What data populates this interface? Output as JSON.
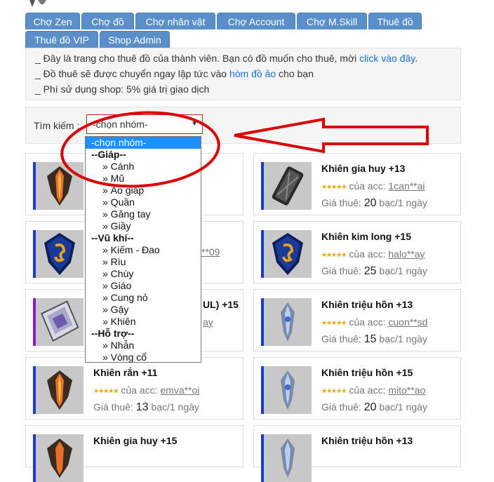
{
  "tabs": [
    "Chợ Zen",
    "Chợ đồ",
    "Chợ nhân vật",
    "Chợ Account",
    "Chợ M.Skill",
    "Thuê đồ",
    "Thuê đồ VIP",
    "Shop Admin"
  ],
  "info": {
    "line1_text": "_ Đây là trang cho thuê đồ của thành viên. Bạn có đồ muốn cho thuê, mời ",
    "line1_link": "click vào đây",
    "line1_end": ".",
    "line2_text": "_ Đồ thuê sẽ được chuyển ngay lập tức vào ",
    "line2_link": "hòm đồ ảo",
    "line2_end": " cho bạn",
    "line3_text": "_ Phí sử dụng shop: 5% giá trị giao dịch"
  },
  "search": {
    "label": "Tìm kiếm :",
    "selected": "-chọn nhóm-"
  },
  "dropdown": {
    "selected": "-chọn nhóm-",
    "groups": [
      {
        "label": "--Giáp--",
        "options": [
          "» Cánh",
          "» Mũ",
          "» Áo giáp",
          "» Quần",
          "» Găng tay",
          "» Giầy"
        ]
      },
      {
        "label": "--Vũ khí--",
        "options": [
          "» Kiếm - Đao",
          "» Rìu",
          "» Chùy",
          "» Giáo",
          "» Cung nỏ",
          "» Gậy",
          "» Khiên"
        ]
      },
      {
        "label": "--Hỗ trợ--",
        "options": [
          "» Nhẫn",
          "» Vòng cổ"
        ]
      }
    ]
  },
  "cards": [
    {
      "title": "",
      "acc_prefix": "",
      "acc": "",
      "price": "",
      "unit": ""
    },
    {
      "title": "Khiên gia huy +13",
      "acc_prefix": "của acc:",
      "acc": "1can**ai",
      "price": "20",
      "unit": "bạc/1 ngày"
    },
    {
      "title": "",
      "acc_prefix": "",
      "acc": "**09",
      "price": "",
      "unit": ""
    },
    {
      "title": "Khiên kim long +15",
      "acc_prefix": "của acc:",
      "acc": "halo**ay",
      "price": "25",
      "unit": "bạc/1 ngày"
    },
    {
      "title": "UL) +15",
      "acc_prefix": "",
      "acc": "ay",
      "price": "",
      "unit": ""
    },
    {
      "title": "Khiên triệu hồn +13",
      "acc_prefix": "của acc:",
      "acc": "cuon**sd",
      "price": "15",
      "unit": "bạc/1 ngày"
    },
    {
      "title": "Khiên rắn +11",
      "acc_prefix": "của acc:",
      "acc": "emva**oi",
      "price": "13",
      "unit": "bạc/1 ngày"
    },
    {
      "title": "Khiên triệu hồn +15",
      "acc_prefix": "của acc:",
      "acc": "mito**ao",
      "price": "20",
      "unit": "bạc/1 ngày"
    },
    {
      "title": "Khiên gia huy +15",
      "acc_prefix": "",
      "acc": "",
      "price": "",
      "unit": ""
    },
    {
      "title": "Khiên triệu hồn +13",
      "acc_prefix": "",
      "acc": "",
      "price": "",
      "unit": ""
    }
  ],
  "labels": {
    "price_prefix": "Giá thuê:"
  },
  "icons": {
    "stars": "★★★★★",
    "select_arrow": "▼"
  },
  "colors": {
    "tab": "#5a8fc9",
    "annotation": "#dd0000",
    "link": "#1a6fd0",
    "rank_bar": "#1a3ad6",
    "rank_bar_alt": "#8a1ad6"
  }
}
